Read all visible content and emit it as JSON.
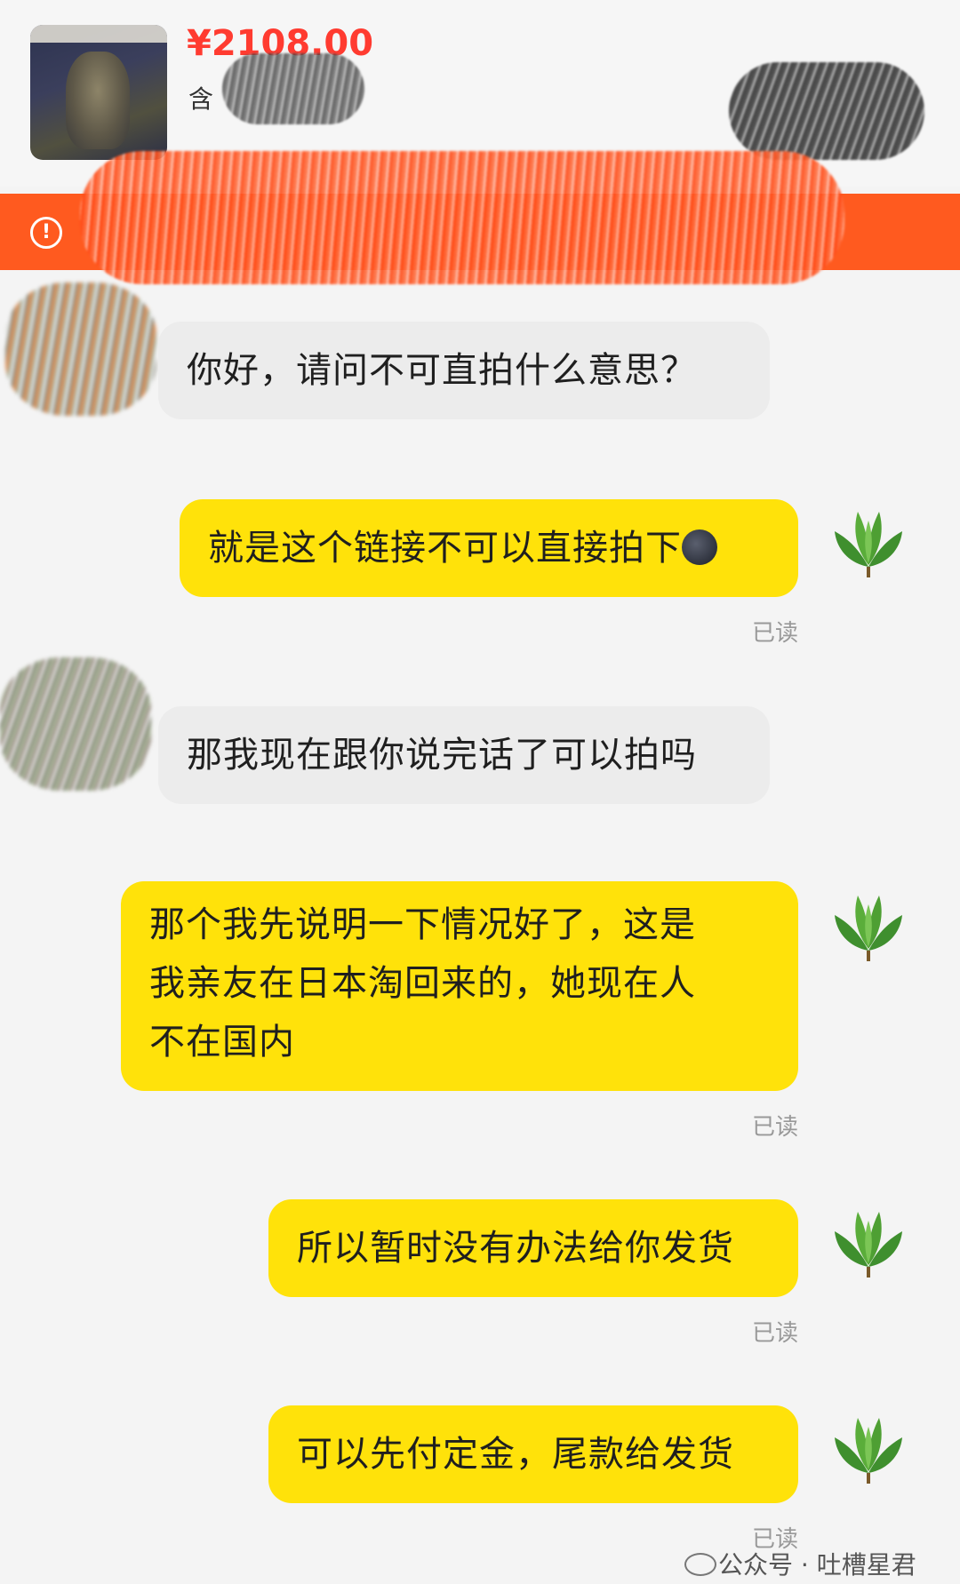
{
  "product": {
    "price": "¥2108.00",
    "subtitle": "含"
  },
  "notice_icon": "alert-circle-icon",
  "messages": [
    {
      "side": "in",
      "text": "你好，请问不可直拍什么意思？"
    },
    {
      "side": "out",
      "text": "就是这个链接不可以直接拍下",
      "emoji": "new-moon-face-icon",
      "status": "已读"
    },
    {
      "side": "in",
      "text": "那我现在跟你说完话了可以拍吗"
    },
    {
      "side": "out",
      "lines": [
        "那个我先说明一下情况好了，这是",
        "我亲友在日本淘回来的，她现在人",
        "不在国内"
      ],
      "status": "已读"
    },
    {
      "side": "out",
      "text": "所以暂时没有办法给你发货",
      "status": "已读"
    },
    {
      "side": "out",
      "text": "可以先付定金，尾款给发货",
      "status": "已读"
    }
  ],
  "watermark": "公众号 · 吐槽星君",
  "colors": {
    "notice_bar": "#ff5a1f",
    "price": "#ff3b30",
    "out_bubble": "#ffe20a",
    "in_bubble": "#ececec"
  }
}
